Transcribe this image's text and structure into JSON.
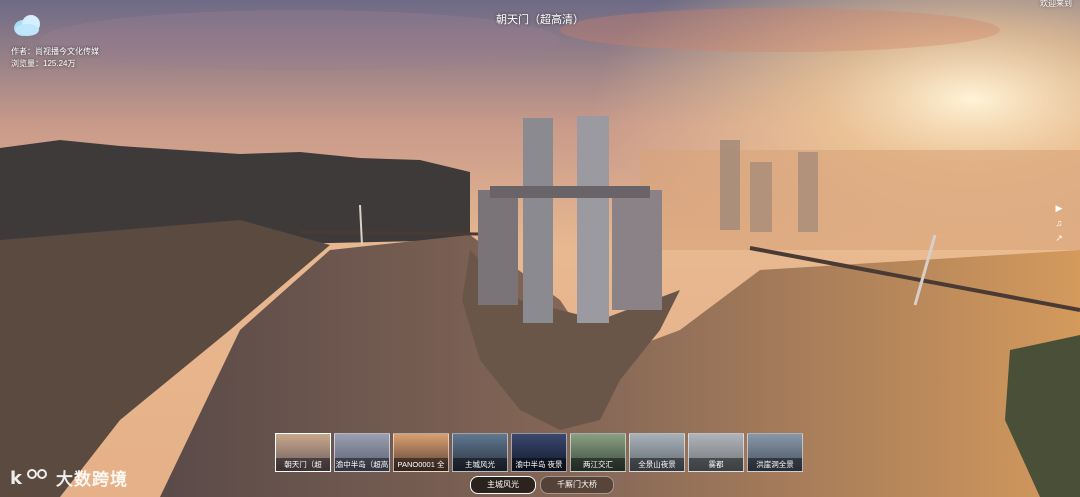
{
  "tour": {
    "title": "朝天门（超高清）",
    "corner_text": "欢迎来到",
    "author": "作者：尚视播今文化传媒",
    "views": "浏览量：125.24万"
  },
  "side_buttons": [
    {
      "icon": "video-icon",
      "glyph": "▶"
    },
    {
      "icon": "music-icon",
      "glyph": "♫"
    },
    {
      "icon": "share-icon",
      "glyph": "↗"
    }
  ],
  "thumbnails": [
    {
      "label": "朝天门（超",
      "colors": [
        "#c9a88a",
        "#6a5a60"
      ]
    },
    {
      "label": "渝中半岛（超高",
      "colors": [
        "#9aa0b0",
        "#585e70"
      ]
    },
    {
      "label": "PANO0001 全",
      "colors": [
        "#d9a070",
        "#5a4038"
      ]
    },
    {
      "label": "主城风光",
      "colors": [
        "#607890",
        "#2a3240"
      ]
    },
    {
      "label": "渝中半岛 夜景",
      "colors": [
        "#3a4870",
        "#101828"
      ]
    },
    {
      "label": "两江交汇",
      "colors": [
        "#8aa080",
        "#3a4a40"
      ]
    },
    {
      "label": "全景山夜景",
      "colors": [
        "#a8b0b8",
        "#606870"
      ]
    },
    {
      "label": "雾都",
      "colors": [
        "#b0b4b8",
        "#707478"
      ]
    },
    {
      "label": "洪崖洞全景",
      "colors": [
        "#8898a8",
        "#485060"
      ]
    }
  ],
  "groups": [
    "主城风光",
    "千厮门大桥"
  ],
  "watermark": "大数跨境",
  "colors": {
    "accent": "#ffffff",
    "sky_top": "#6a6a8a",
    "sky_glow": "#f4c48a"
  }
}
